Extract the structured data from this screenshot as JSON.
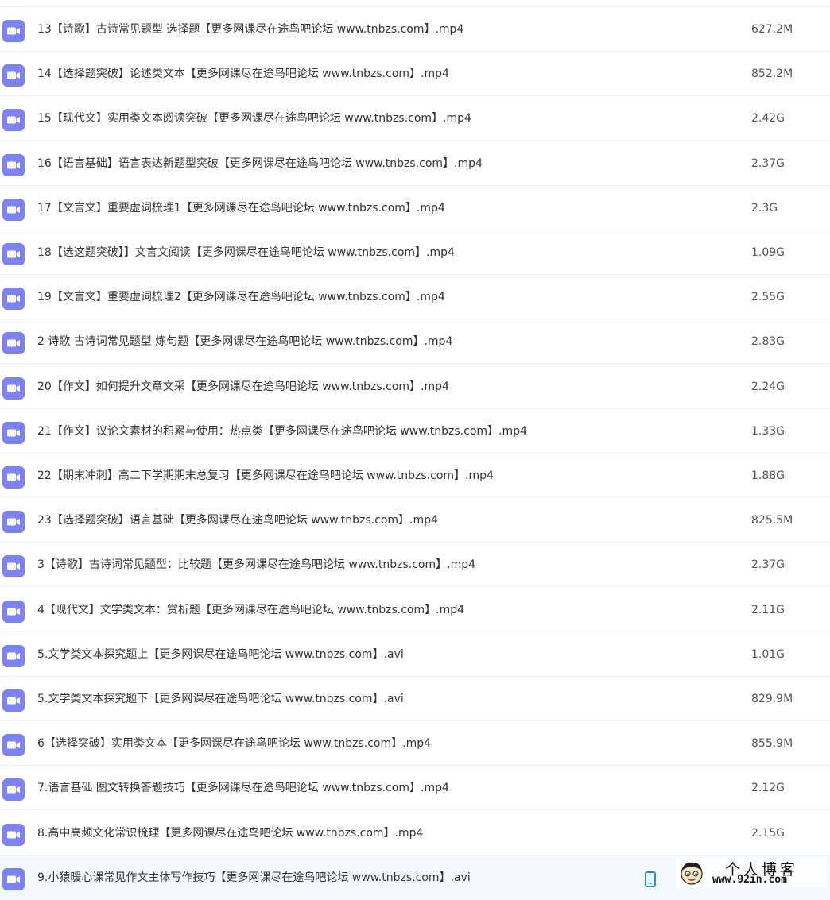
{
  "file_list": {
    "icon": "video-file-icon",
    "icon_color": "#7b83f5",
    "rows": [
      {
        "name": "13【诗歌】古诗常见题型 选择题【更多网课尽在途鸟吧论坛 www.tnbzs.com】.mp4",
        "size": "627.2M"
      },
      {
        "name": "14【选择题突破】论述类文本【更多网课尽在途鸟吧论坛 www.tnbzs.com】.mp4",
        "size": "852.2M"
      },
      {
        "name": "15【现代文】实用类文本阅读突破【更多网课尽在途鸟吧论坛 www.tnbzs.com】.mp4",
        "size": "2.42G"
      },
      {
        "name": "16【语言基础】语言表达新题型突破【更多网课尽在途鸟吧论坛 www.tnbzs.com】.mp4",
        "size": "2.37G"
      },
      {
        "name": "17【文言文】重要虚词梳理1【更多网课尽在途鸟吧论坛 www.tnbzs.com】.mp4",
        "size": "2.3G"
      },
      {
        "name": "18【选这题突破】】文言文阅读【更多网课尽在途鸟吧论坛 www.tnbzs.com】.mp4",
        "size": "1.09G"
      },
      {
        "name": "19【文言文】重要虚词梳理2【更多网课尽在途鸟吧论坛 www.tnbzs.com】.mp4",
        "size": "2.55G"
      },
      {
        "name": "2 诗歌 古诗词常见题型 炼句题【更多网课尽在途鸟吧论坛 www.tnbzs.com】.mp4",
        "size": "2.83G"
      },
      {
        "name": "20【作文】如何提升文章文采【更多网课尽在途鸟吧论坛 www.tnbzs.com】.mp4",
        "size": "2.24G"
      },
      {
        "name": "21【作文】议论文素材的积累与使用：热点类【更多网课尽在途鸟吧论坛 www.tnbzs.com】.mp4",
        "size": "1.33G"
      },
      {
        "name": "22【期末冲刺】高二下学期期末总复习【更多网课尽在途鸟吧论坛 www.tnbzs.com】.mp4",
        "size": "1.88G"
      },
      {
        "name": "23【选择题突破】语言基础【更多网课尽在途鸟吧论坛 www.tnbzs.com】.mp4",
        "size": "825.5M"
      },
      {
        "name": "3【诗歌】古诗词常见题型：比较题【更多网课尽在途鸟吧论坛 www.tnbzs.com】.mp4",
        "size": "2.37G"
      },
      {
        "name": "4【现代文】文学类文本：赏析题【更多网课尽在途鸟吧论坛 www.tnbzs.com】.mp4",
        "size": "2.11G"
      },
      {
        "name": "5.文学类文本探究题上【更多网课尽在途鸟吧论坛 www.tnbzs.com】.avi",
        "size": "1.01G"
      },
      {
        "name": "5.文学类文本探究题下【更多网课尽在途鸟吧论坛 www.tnbzs.com】.avi",
        "size": "829.9M"
      },
      {
        "name": "6【选择突破】实用类文本【更多网课尽在途鸟吧论坛 www.tnbzs.com】.mp4",
        "size": "855.9M"
      },
      {
        "name": "7.语言基础 图文转换答题技巧【更多网课尽在途鸟吧论坛 www.tnbzs.com】.mp4",
        "size": "2.12G"
      },
      {
        "name": "8.高中高频文化常识梳理【更多网课尽在途鸟吧论坛 www.tnbzs.com】.mp4",
        "size": "2.15G"
      },
      {
        "name": "9.小猿暖心课常见作文主体写作技巧【更多网课尽在途鸟吧论坛 www.tnbzs.com】.avi",
        "size": ""
      }
    ]
  },
  "hovered_row_actions": {
    "icon": "phone-icon",
    "color": "#1a8cff"
  },
  "watermark": {
    "title": "个人博客",
    "url": "www.92in.com",
    "icon": "cartoon-face-icon"
  }
}
